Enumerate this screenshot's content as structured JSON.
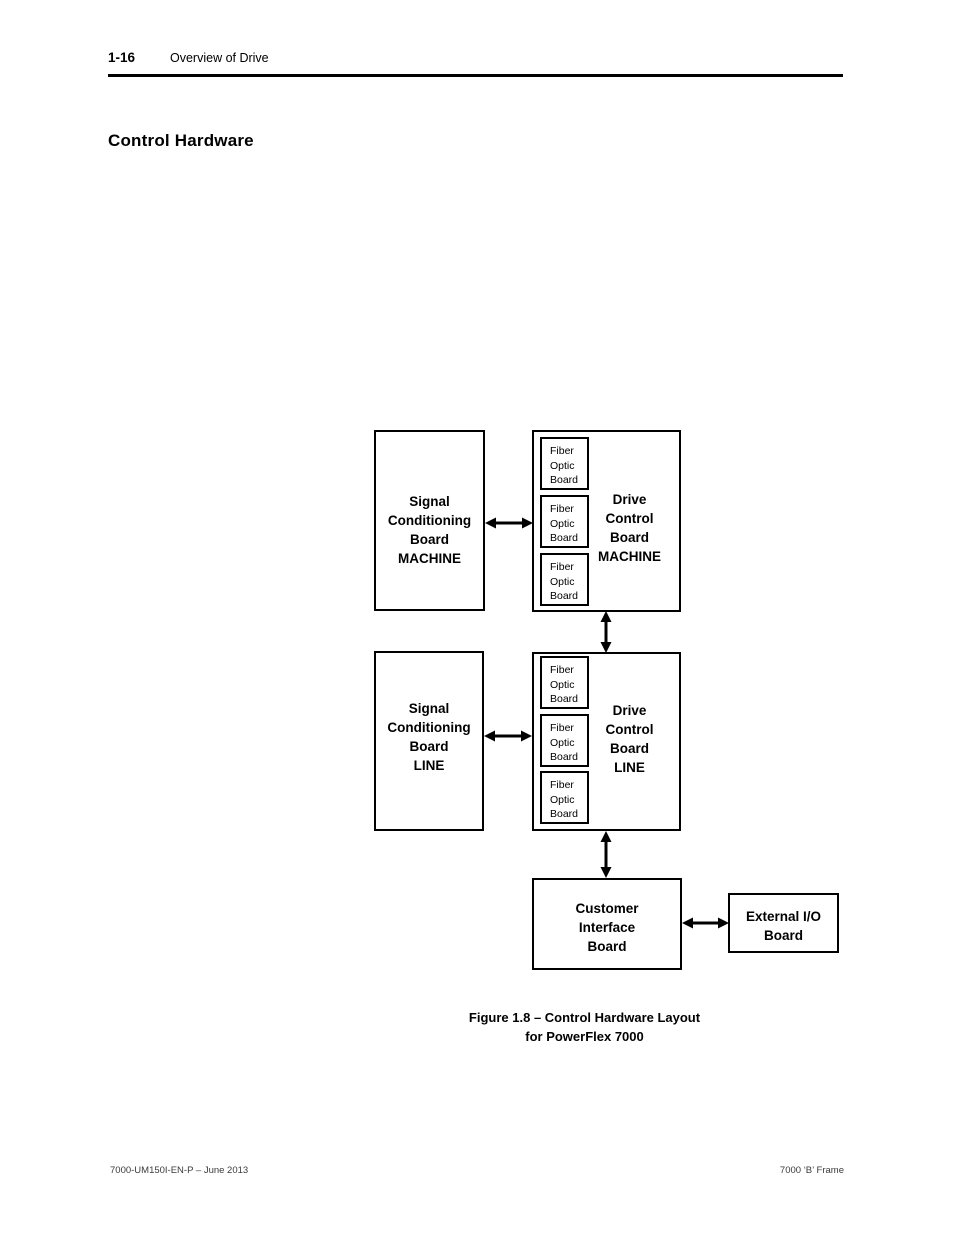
{
  "header": {
    "page_number": "1-16",
    "section_title": "Overview of Drive"
  },
  "section_heading": "Control Hardware",
  "figure": {
    "caption_line1": "Figure 1.8 – Control Hardware Layout",
    "caption_line2": "for PowerFlex 7000",
    "boxes": {
      "signal_conditioning_machine": "Signal\nConditioning\nBoard\nMACHINE",
      "drive_control_machine": "Drive\nControl\nBoard\nMACHINE",
      "signal_conditioning_line": "Signal\nConditioning\nBoard\nLINE",
      "drive_control_line": "Drive\nControl\nBoard\nLINE",
      "customer_interface": "Customer\nInterface\nBoard",
      "external_io": "External I/O\nBoard"
    },
    "fiber_optic_board": "Fiber\nOptic\nBoard",
    "fiber_optic_boards": [
      "Fiber\nOptic\nBoard",
      "Fiber\nOptic\nBoard",
      "Fiber\nOptic\nBoard",
      "Fiber\nOptic\nBoard",
      "Fiber\nOptic\nBoard",
      "Fiber\nOptic\nBoard"
    ],
    "colors": {
      "line": "#000000",
      "box_fill": "#ffffff",
      "text": "#000000"
    }
  },
  "footer": {
    "left": "7000-UM150I-EN-P – June 2013",
    "right": "7000 ‘B’ Frame"
  }
}
